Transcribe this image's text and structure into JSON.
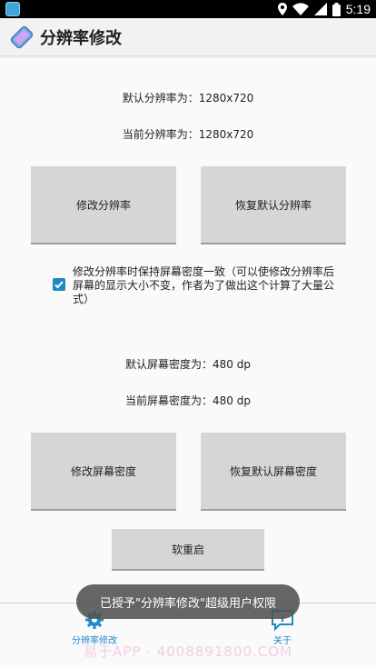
{
  "status_bar": {
    "time": "5:19"
  },
  "app_bar": {
    "title": "分辨率修改"
  },
  "resolution": {
    "default_text": "默认分辨率为：1280x720",
    "current_text": "当前分辨率为：1280x720",
    "modify_button": "修改分辨率",
    "restore_button": "恢复默认分辨率"
  },
  "density_checkbox": {
    "checked": true,
    "label": "修改分辨率时保持屏幕密度一致（可以使修改分辨率后屏幕的显示大小不变，作者为了做出这个计算了大量公式）"
  },
  "density": {
    "default_text": "默认屏幕密度为：480 dp",
    "current_text": "当前屏幕密度为：480 dp",
    "modify_button": "修改屏幕密度",
    "restore_button": "恢复默认屏幕密度"
  },
  "soft_reboot_button": "软重启",
  "toast": "已授予\"分辨率修改\"超级用户权限",
  "bottom_nav": {
    "tabs": [
      {
        "label": "分辨率修改",
        "icon": "gear-icon",
        "active": true
      },
      {
        "label": "关于",
        "icon": "chat-bubble-icon",
        "active": false
      }
    ]
  },
  "watermark": "易于APP · 4008891800.COM",
  "colors": {
    "accent": "#1e88c9",
    "button_bg": "#d6d6d6",
    "toast_bg": "#505050"
  }
}
